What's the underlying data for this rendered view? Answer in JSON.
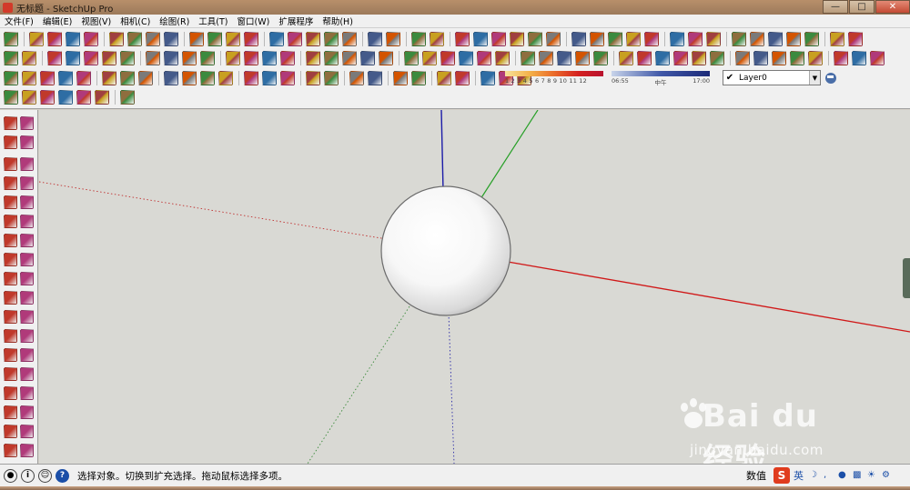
{
  "window": {
    "title": "无标题 - SketchUp Pro"
  },
  "menu": [
    "文件(F)",
    "编辑(E)",
    "视图(V)",
    "相机(C)",
    "绘图(R)",
    "工具(T)",
    "窗口(W)",
    "扩展程序",
    "帮助(H)"
  ],
  "toolbar": {
    "color_scale_numbers": "1 2 3 4 5 6 7 8 9 10 11 12",
    "time_start": "06:55",
    "time_mid": "中午",
    "time_end": "17:00",
    "layer_value": "Layer0",
    "layer_checkmark": "✔"
  },
  "status": {
    "hint": "选择对象。切换到扩充选择。拖动鼠标选择多项。",
    "measurements_label": "数值",
    "ime_language": "英"
  },
  "watermark": {
    "brand": "Bai du 经验",
    "url": "jingyan.baidu.com"
  },
  "colors": {
    "axis_red": "#d01818",
    "axis_green": "#28a028",
    "axis_blue": "#1c1ca8",
    "viewport_bg": "#d9d9d4"
  }
}
